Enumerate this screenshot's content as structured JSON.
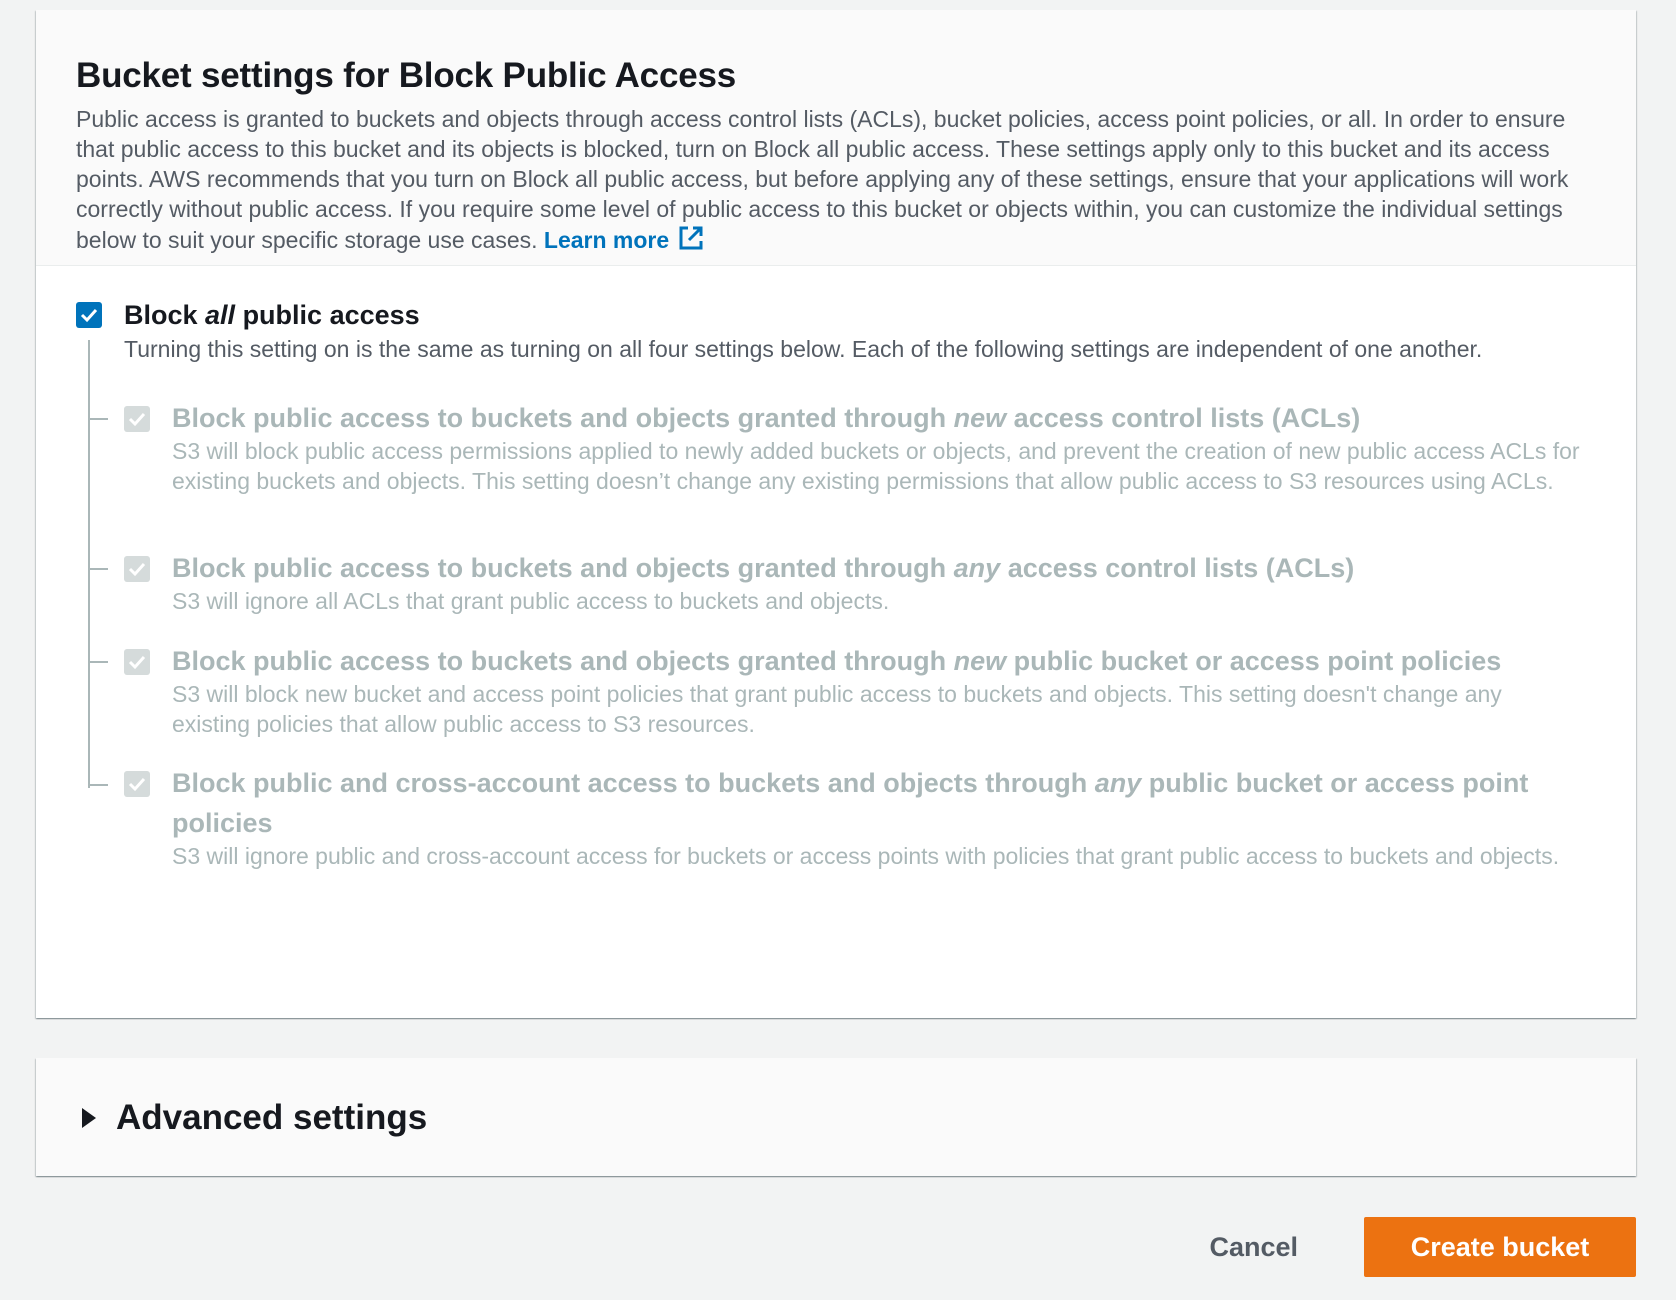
{
  "section": {
    "title": "Bucket settings for Block Public Access",
    "description": "Public access is granted to buckets and objects through access control lists (ACLs), bucket policies, access point policies, or all. In order to ensure that public access to this bucket and its objects is blocked, turn on Block all public access. These settings apply only to this bucket and its access points. AWS recommends that you turn on Block all public access, but before applying any of these settings, ensure that your applications will work correctly without public access. If you require some level of public access to this bucket or objects within, you can customize the individual settings below to suit your specific storage use cases.",
    "learn_more": "Learn more",
    "learn_more_icon": "external-link-icon"
  },
  "block_all": {
    "label_pre": "Block ",
    "label_em": "all",
    "label_post": " public access",
    "hint": "Turning this setting on is the same as turning on all four settings below. Each of the following settings are independent of one another.",
    "checked": true
  },
  "sub_options": [
    {
      "label_pre": "Block public access to buckets and objects granted through ",
      "label_em": "new",
      "label_post": " access control lists (ACLs)",
      "hint": "S3 will block public access permissions applied to newly added buckets or objects, and prevent the creation of new public access ACLs for existing buckets and objects. This setting doesn’t change any existing permissions that allow public access to S3 resources using ACLs.",
      "checked": true,
      "disabled": true
    },
    {
      "label_pre": "Block public access to buckets and objects granted through ",
      "label_em": "any",
      "label_post": " access control lists (ACLs)",
      "hint": "S3 will ignore all ACLs that grant public access to buckets and objects.",
      "checked": true,
      "disabled": true
    },
    {
      "label_pre": "Block public access to buckets and objects granted through ",
      "label_em": "new",
      "label_post": " public bucket or access point policies",
      "hint": "S3 will block new bucket and access point policies that grant public access to buckets and objects. This setting doesn't change any existing policies that allow public access to S3 resources.",
      "checked": true,
      "disabled": true
    },
    {
      "label_pre": "Block public and cross-account access to buckets and objects through ",
      "label_em": "any",
      "label_post": " public bucket or access point policies",
      "hint": "S3 will ignore public and cross-account access for buckets or access points with policies that grant public access to buckets and objects.",
      "checked": true,
      "disabled": true
    }
  ],
  "advanced": {
    "label": "Advanced settings",
    "icon": "caret-right-icon",
    "expanded": false
  },
  "footer": {
    "cancel_label": "Cancel",
    "create_label": "Create bucket"
  },
  "colors": {
    "primary": "#ec7211",
    "link": "#0073bb",
    "checkbox_on": "#0073bb",
    "checkbox_disabled": "#d5dbdb",
    "disabled_text": "#aab7b8"
  }
}
